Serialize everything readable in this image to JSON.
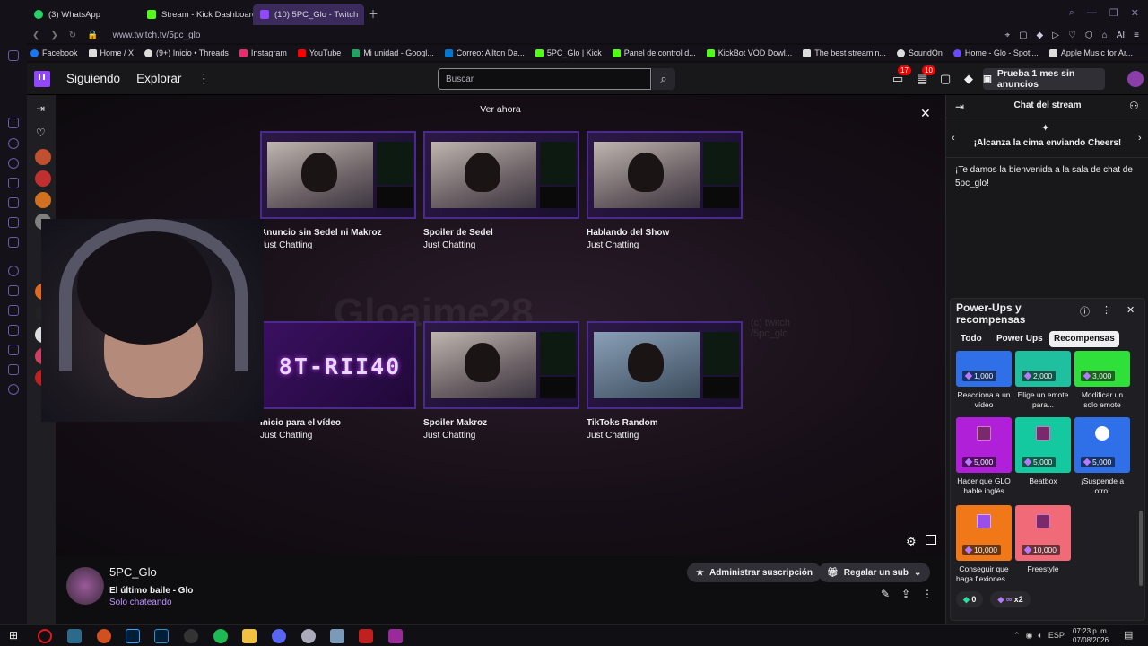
{
  "browser": {
    "tabs": [
      {
        "label": "(3) WhatsApp",
        "color": "#25d366"
      },
      {
        "label": "Stream - Kick Dashboard",
        "color": "#53fc18"
      },
      {
        "label": "(10) 5PC_Glo - Twitch",
        "color": "#9146ff"
      }
    ],
    "url": "www.twitch.tv/5pc_glo",
    "bookmarks": [
      {
        "label": "Facebook",
        "color": "#1877f2"
      },
      {
        "label": "Home / X",
        "color": "#ffffff"
      },
      {
        "label": "(9+) Inicio • Threads",
        "color": "#ffffff"
      },
      {
        "label": "Instagram",
        "color": "#e1306c"
      },
      {
        "label": "YouTube",
        "color": "#ff0000"
      },
      {
        "label": "Mi unidad - Googl...",
        "color": "#1fa463"
      },
      {
        "label": "Correo: Ailton Da...",
        "color": "#0078d4"
      },
      {
        "label": "5PC_Glo | Kick",
        "color": "#53fc18"
      },
      {
        "label": "Panel de control d...",
        "color": "#53fc18"
      },
      {
        "label": "KickBot VOD Dowl...",
        "color": "#53fc18"
      },
      {
        "label": "The best streamin...",
        "color": "#ffffff"
      },
      {
        "label": "SoundOn",
        "color": "#ffffff"
      },
      {
        "label": "Home - Glo - Spoti...",
        "color": "#6a4cff"
      },
      {
        "label": "Apple Music for Ar...",
        "color": "#ffffff"
      }
    ]
  },
  "nav": {
    "following": "Siguiendo",
    "explore": "Explorar",
    "more": "⋮",
    "search_placeholder": "Buscar",
    "notifications_badge": "17",
    "inbox_badge": "10",
    "promo": "Prueba 1 mes sin anuncios"
  },
  "player": {
    "watch_now": "Ver ahora",
    "watermark": "Gloaime28",
    "watermark_handle": "(c) twitch\n/5pc_glo",
    "cards": [
      {
        "title": "Anuncio sin Sedel ni Makroz",
        "category": "Just Chatting"
      },
      {
        "title": "Spoiler de Sedel",
        "category": "Just Chatting"
      },
      {
        "title": "Hablando del Show",
        "category": "Just Chatting"
      },
      {
        "title": "Inicio para el vídeo",
        "category": "Just Chatting",
        "logo": "8T-RII40"
      },
      {
        "title": "Spoiler Makroz",
        "category": "Just Chatting"
      },
      {
        "title": "TikToks Random",
        "category": "Just Chatting"
      }
    ]
  },
  "channel": {
    "name": "5PC_Glo",
    "stream_title": "El último baile - Glo",
    "category": "Solo chateando",
    "manage_sub": "Administrar suscripción",
    "gift_sub": "Regalar un sub"
  },
  "chat": {
    "title": "Chat del stream",
    "cheers": "¡Alcanza la cima enviando Cheers!",
    "welcome": "¡Te damos la bienvenida a la sala de chat de 5pc_glo!",
    "powerups": {
      "title": "Power-Ups y recompensas",
      "tabs": [
        "Todo",
        "Power Ups",
        "Recompensas"
      ],
      "selected_tab": "Recompensas",
      "rewards": [
        {
          "cost": "1,000",
          "label": "Reacciona a un vídeo",
          "color": "#2f6fe8"
        },
        {
          "cost": "2,000",
          "label": "Elige un emote para...",
          "color": "#1fc0a0"
        },
        {
          "cost": "3,000",
          "label": "Modificar un solo emote",
          "color": "#2fe03a"
        },
        {
          "cost": "5,000",
          "label": "Hacer que GLO hable inglés",
          "color": "#b020d8"
        },
        {
          "cost": "5,000",
          "label": "Beatbox",
          "color": "#14c8a0"
        },
        {
          "cost": "5,000",
          "label": "¡Suspende a otro!",
          "color": "#2f6fe8"
        },
        {
          "cost": "10,000",
          "label": "Conseguir que haga flexiones...",
          "color": "#f07818"
        },
        {
          "cost": "10,000",
          "label": "Freestyle",
          "color": "#f06a78"
        }
      ],
      "points": "0",
      "multiplier": "x2"
    }
  },
  "taskbar": {
    "time": "07:23 p. m.",
    "date": "07/08/2026"
  }
}
